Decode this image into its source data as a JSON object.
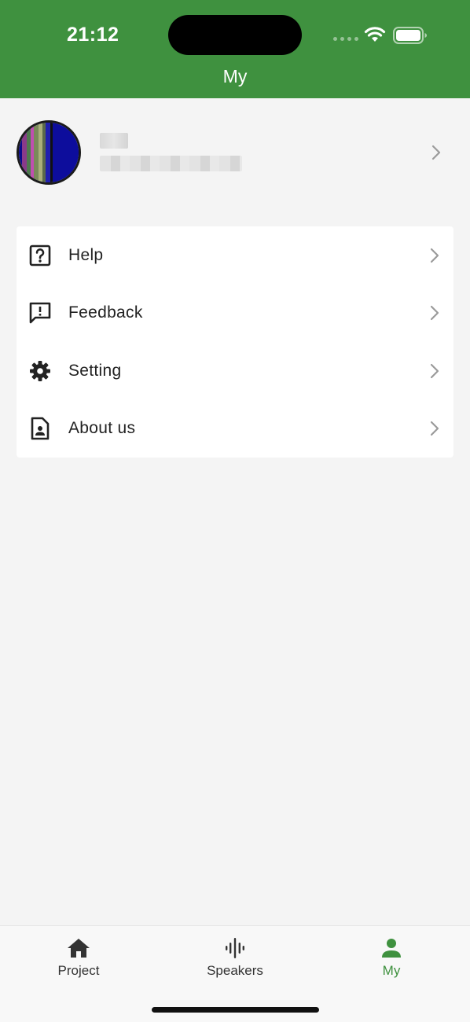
{
  "status_bar": {
    "time": "21:12"
  },
  "header": {
    "title": "My"
  },
  "menu": {
    "items": [
      {
        "label": "Help",
        "icon": "help-icon"
      },
      {
        "label": "Feedback",
        "icon": "feedback-icon"
      },
      {
        "label": "Setting",
        "icon": "gear-icon"
      },
      {
        "label": "About us",
        "icon": "about-icon"
      }
    ]
  },
  "tabbar": {
    "tabs": [
      {
        "label": "Project",
        "icon": "home-icon"
      },
      {
        "label": "Speakers",
        "icon": "audio-wave-icon"
      },
      {
        "label": "My",
        "icon": "person-icon",
        "active": true
      }
    ]
  },
  "colors": {
    "accent": "#3f913f",
    "background": "#f4f4f4",
    "card": "#ffffff",
    "text": "#222222",
    "chevron": "#9a9a9a"
  }
}
